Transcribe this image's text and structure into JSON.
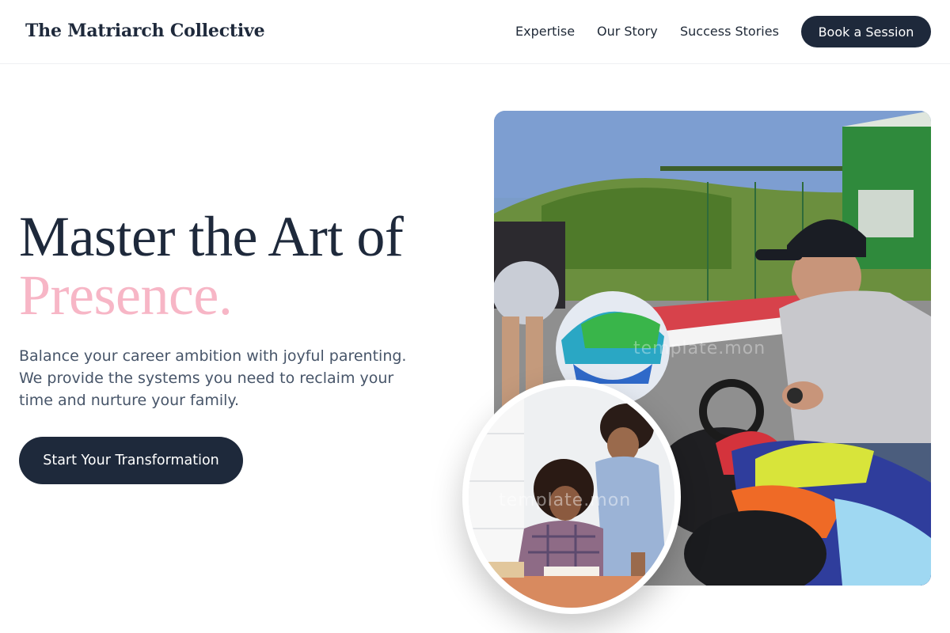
{
  "header": {
    "brand": "The Matriarch Collective",
    "nav": [
      "Expertise",
      "Our Story",
      "Success Stories"
    ],
    "cta": "Book a Session"
  },
  "hero": {
    "title_line1": "Master the Art of",
    "title_line2": "Presence.",
    "description": "Balance your career ambition with joyful parenting. We provide the systems you need to reclaim your time and nurture your family.",
    "cta": "Start Your Transformation"
  },
  "images": {
    "main_alt": "kart-racing-photo",
    "secondary_alt": "mother-child-studying-photo",
    "watermark": "template.mon"
  },
  "colors": {
    "primary": "#1e293b",
    "accent": "#f7b6c6",
    "text_muted": "#475569"
  }
}
